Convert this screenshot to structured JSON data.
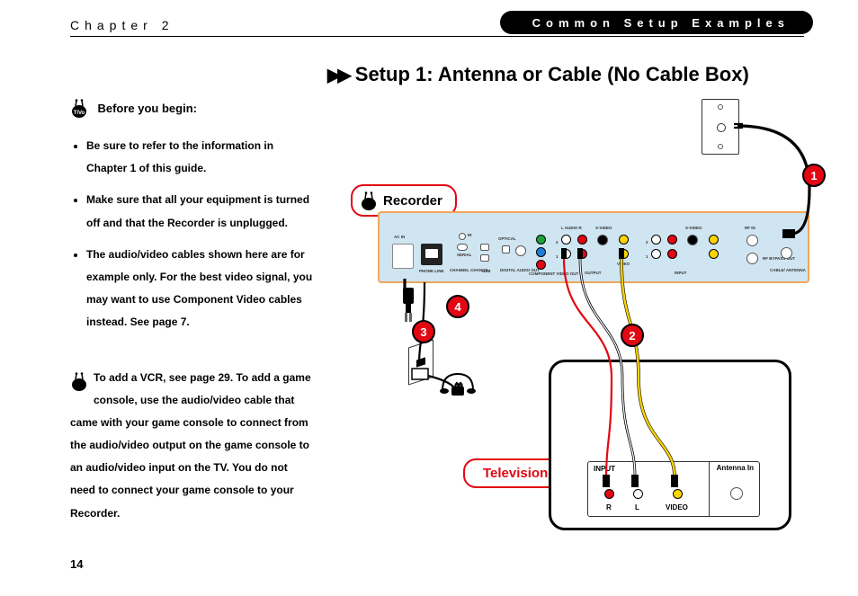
{
  "header": {
    "chapter": "Chapter 2",
    "section": "Common Setup Examples"
  },
  "heading": "Setup 1: Antenna or Cable (No Cable Box)",
  "before_begin": {
    "title": "Before you begin:",
    "bullets": [
      "Be sure to refer to the information in Chapter 1 of this guide.",
      "Make sure that all your equipment is turned off and that the Recorder is unplugged.",
      "The audio/video cables shown here are for example only. For the best video signal, you may want to use Component Video cables instead. See page 7."
    ]
  },
  "note": "To add a VCR, see page 29. To add a game console, use the audio/video cable that came with your game console to connect from the audio/video output on the game console to an audio/video input on the TV. You do not need to connect your game console to your Recorder.",
  "page_number": "14",
  "devices": {
    "recorder_label": "Recorder",
    "television_label": "Television"
  },
  "recorder_ports": {
    "ac_in": "AC IN",
    "phone_line": "PHONE LINE",
    "ir": "IR",
    "serial": "SERIAL",
    "channel_change": "CHANNEL\nCHANGE",
    "usb": "USB",
    "optical": "OPTICAL",
    "digital_audio_out": "DIGITAL\nAUDIO OUT",
    "component_video_out": "COMPONENT\nVIDEO OUT",
    "audio_lr": "L   AUDIO   R",
    "svideo": "S-VIDEO",
    "video": "VIDEO",
    "output": "OUTPUT",
    "input": "INPUT",
    "rf_in": "RF IN",
    "rf_bypass_out": "RF BYPASS OUT",
    "cable_antenna": "CABLE/\nANTENNA",
    "n1": "1",
    "n2": "2"
  },
  "tv_panel": {
    "input": "INPUT",
    "r": "R",
    "l": "L",
    "video": "VIDEO",
    "antenna_in": "Antenna\nIn"
  },
  "badges": {
    "b1": "1",
    "b2": "2",
    "b3": "3",
    "b4": "4"
  },
  "colors": {
    "accent": "#e30613",
    "recorder_bg": "#cfe5f1",
    "recorder_border": "#f2a65a"
  }
}
